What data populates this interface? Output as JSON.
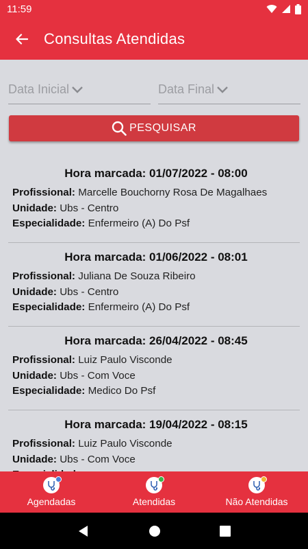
{
  "status_bar": {
    "time": "11:59"
  },
  "app_bar": {
    "title": "Consultas Atendidas"
  },
  "filters": {
    "start_date": "Data Inicial",
    "end_date": "Data Final"
  },
  "search_button": {
    "label": "PESQUISAR"
  },
  "labels": {
    "professional": "Profissional:",
    "unit": "Unidade:",
    "specialty": "Especialidade:"
  },
  "appointments": [
    {
      "title": "Hora marcada: 01/07/2022 - 08:00",
      "professional": "Marcelle Bouchorny Rosa De Magalhaes",
      "unit": "Ubs - Centro",
      "specialty": "Enfermeiro (A) Do Psf"
    },
    {
      "title": "Hora marcada: 01/06/2022 - 08:01",
      "professional": "Juliana De Souza Ribeiro",
      "unit": "Ubs - Centro",
      "specialty": "Enfermeiro (A) Do Psf"
    },
    {
      "title": "Hora marcada: 26/04/2022 - 08:45",
      "professional": "Luiz Paulo Visconde",
      "unit": "Ubs - Com Voce",
      "specialty": "Medico Do Psf"
    },
    {
      "title": "Hora marcada: 19/04/2022 - 08:15",
      "professional": "Luiz Paulo Visconde",
      "unit": "Ubs - Com Voce",
      "specialty": ""
    }
  ],
  "bottom_nav": [
    {
      "label": "Agendadas",
      "icon": "stethoscope-icon",
      "badge_color": "#4a7fd9"
    },
    {
      "label": "Atendidas",
      "icon": "stethoscope-icon",
      "badge_color": "#3bb34a"
    },
    {
      "label": "Não Atendidas",
      "icon": "stethoscope-icon",
      "badge_color": "#f2b632"
    }
  ],
  "colors": {
    "primary": "#e5313f",
    "button": "#d03a40",
    "background": "#d9dadf"
  }
}
